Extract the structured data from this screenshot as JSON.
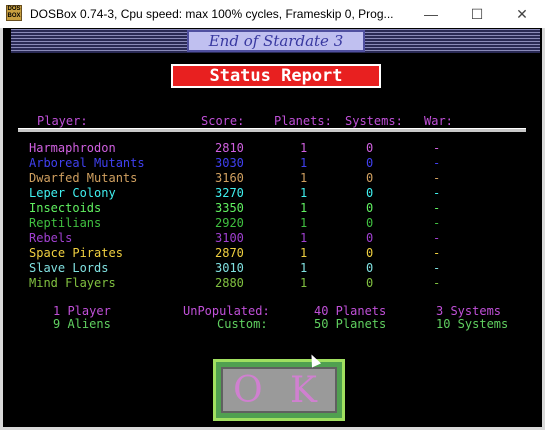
{
  "window": {
    "title": "DOSBox 0.74-3, Cpu speed: max 100% cycles, Frameskip  0, Prog...",
    "icon_text": "DOS BOX",
    "min_glyph": "—",
    "max_glyph": "☐",
    "close_glyph": "✕"
  },
  "game": {
    "title": "End of Stardate 3",
    "report_title": "Status Report"
  },
  "table": {
    "headers": {
      "player": "Player:",
      "score": "Score:",
      "planets": "Planets:",
      "systems": "Systems:",
      "war": "War:"
    },
    "rows": [
      {
        "name": "Harmaphrodon",
        "score": "2810",
        "planets": "1",
        "systems": "0",
        "war": "-",
        "color": "#d060e0"
      },
      {
        "name": "Arboreal Mutants",
        "score": "3030",
        "planets": "1",
        "systems": "0",
        "war": "-",
        "color": "#4040f0"
      },
      {
        "name": "Dwarfed Mutants",
        "score": "3160",
        "planets": "1",
        "systems": "0",
        "war": "-",
        "color": "#d0a060"
      },
      {
        "name": "Leper Colony",
        "score": "3270",
        "planets": "1",
        "systems": "0",
        "war": "-",
        "color": "#40f0f0"
      },
      {
        "name": "Insectoids",
        "score": "3350",
        "planets": "1",
        "systems": "0",
        "war": "-",
        "color": "#60f060"
      },
      {
        "name": "Reptilians",
        "score": "2920",
        "planets": "1",
        "systems": "0",
        "war": "-",
        "color": "#40c040"
      },
      {
        "name": "Rebels",
        "score": "3100",
        "planets": "1",
        "systems": "0",
        "war": "-",
        "color": "#a040d0"
      },
      {
        "name": "Space Pirates",
        "score": "2870",
        "planets": "1",
        "systems": "0",
        "war": "-",
        "color": "#f0d040"
      },
      {
        "name": "Slave Lords",
        "score": "3010",
        "planets": "1",
        "systems": "0",
        "war": "-",
        "color": "#80e0e0"
      },
      {
        "name": "Mind Flayers",
        "score": "2880",
        "planets": "1",
        "systems": "0",
        "war": "-",
        "color": "#80c040"
      }
    ]
  },
  "footer": {
    "players": "1 Player",
    "aliens": "9 Aliens",
    "unpopulated_label": "UnPopulated:",
    "custom_label": "Custom:",
    "unpop_planets": "40 Planets",
    "custom_planets": "50 Planets",
    "unpop_systems": "3 Systems",
    "custom_systems": "10 Systems"
  },
  "ok_label": "O K"
}
